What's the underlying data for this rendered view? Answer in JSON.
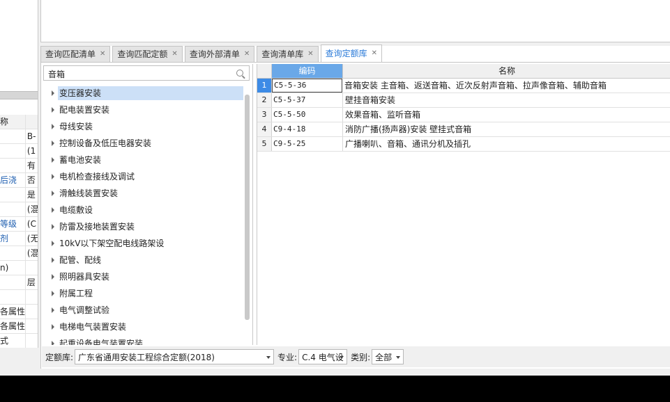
{
  "left_panel": {
    "header_name": "称",
    "rows": [
      {
        "a": "",
        "b": "B-",
        "a_blue": false
      },
      {
        "a": "",
        "b": "(1",
        "a_blue": false
      },
      {
        "a": "",
        "b": "有",
        "a_blue": false
      },
      {
        "a": "后浇",
        "b": "否",
        "a_blue": true
      },
      {
        "a": "",
        "b": "是",
        "a_blue": false
      },
      {
        "a": "",
        "b": "(混",
        "a_blue": false
      },
      {
        "a": "等级",
        "b": "(C",
        "a_blue": true
      },
      {
        "a": "剂",
        "b": "(无",
        "a_blue": true
      },
      {
        "a": "",
        "b": "(混",
        "a_blue": false
      },
      {
        "a": "n)",
        "b": "",
        "a_blue": false
      },
      {
        "a": "",
        "b": "层",
        "a_blue": false
      },
      {
        "a": "",
        "b": "",
        "a_blue": false
      },
      {
        "a": "各属性",
        "b": "",
        "a_blue": false
      },
      {
        "a": "各属性",
        "b": "",
        "a_blue": false
      },
      {
        "a": "式",
        "b": "",
        "a_blue": false
      }
    ]
  },
  "tabs": [
    {
      "label": "查询匹配清单",
      "active": false
    },
    {
      "label": "查询匹配定额",
      "active": false
    },
    {
      "label": "查询外部清单",
      "active": false
    },
    {
      "label": "查询清单库",
      "active": false
    },
    {
      "label": "查询定额库",
      "active": true
    }
  ],
  "search": {
    "value": "音箱"
  },
  "tree": [
    "变压器安装",
    "配电装置安装",
    "母线安装",
    "控制设备及低压电器安装",
    "蓄电池安装",
    "电机检查接线及调试",
    "滑触线装置安装",
    "电缆敷设",
    "防雷及接地装置安装",
    "10kV以下架空配电线路架设",
    "配管、配线",
    "照明器具安装",
    "附属工程",
    "电气调整试验",
    "电梯电气装置安装",
    "起重设备电气装置安装"
  ],
  "table": {
    "col_code": "编码",
    "col_name": "名称",
    "rows": [
      {
        "no": "1",
        "code": "C5-5-36",
        "name": "音箱安装 主音箱、返送音箱、近次反射声音箱、拉声像音箱、辅助音箱"
      },
      {
        "no": "2",
        "code": "C5-5-37",
        "name": "壁挂音箱安装"
      },
      {
        "no": "3",
        "code": "C5-5-50",
        "name": "效果音箱、监听音箱"
      },
      {
        "no": "4",
        "code": "C9-4-18",
        "name": "消防广播(扬声器)安装 壁挂式音箱"
      },
      {
        "no": "5",
        "code": "C9-5-25",
        "name": "广播喇叭、音箱、通讯分机及插孔"
      }
    ]
  },
  "bottom": {
    "lib_label": "定额库:",
    "lib_value": "广东省通用安装工程综合定额(2018)",
    "major_label": "专业:",
    "major_value": "C.4 电气设",
    "cat_label": "类别:",
    "cat_value": "全部"
  }
}
